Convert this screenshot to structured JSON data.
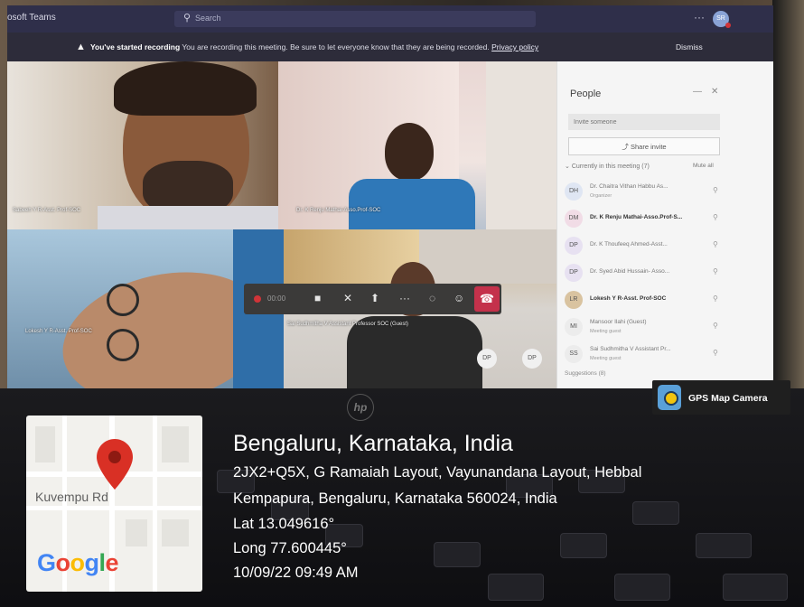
{
  "teams": {
    "app_name": "osoft Teams",
    "search_placeholder": "Search",
    "avatar_initials": "SR"
  },
  "banner": {
    "bold": "You've started recording",
    "message": "You are recording this meeting. Be sure to let everyone know that they are being recorded.",
    "link": "Privacy policy",
    "dismiss": "Dismiss"
  },
  "video": {
    "tiles": [
      {
        "label": "Sabeeh Y R-Asst. Prof-SOC"
      },
      {
        "label": "Dr. K Renju Mathai-Asso.Prof-SOC"
      },
      {
        "label": "Lokesh Y R-Asst. Prof-SOC"
      },
      {
        "label": "Sai Sudhmitha V Assistant Professor SOC (Guest)"
      }
    ],
    "dp_badges": [
      "DP",
      "DP"
    ]
  },
  "controls": {
    "timer": "00:00"
  },
  "people": {
    "title": "People",
    "invite_placeholder": "Invite someone",
    "share_invite": "Share invite",
    "section": "Currently in this meeting (7)",
    "view_all": "Mute all",
    "suggestions": "Suggestions (8)",
    "participants": [
      {
        "initials": "DH",
        "name": "Dr. Chaitra Vithan Habbu As...",
        "sub": "Organizer",
        "bold": false,
        "color": "#dfe6f3"
      },
      {
        "initials": "DM",
        "name": "Dr. K Renju Mathai-Asso.Prof-S...",
        "sub": "",
        "bold": true,
        "color": "#f1dce6"
      },
      {
        "initials": "DP",
        "name": "Dr. K Thoufeeq Ahmed-Asst...",
        "sub": "",
        "bold": false,
        "color": "#e7e1f1"
      },
      {
        "initials": "DP",
        "name": "Dr. Syed Abid Hussain- Asso...",
        "sub": "",
        "bold": false,
        "color": "#e7e1f1"
      },
      {
        "initials": "LR",
        "name": "Lokesh Y R-Asst. Prof-SOC",
        "sub": "",
        "bold": true,
        "color": "#d9c3a0"
      },
      {
        "initials": "MI",
        "name": "Mansoor Ilahi (Guest)",
        "sub": "Meeting guest",
        "bold": false,
        "color": "#ececec"
      },
      {
        "initials": "SS",
        "name": "Sai Sudhmitha V Assistant Pr...",
        "sub": "Meeting guest",
        "bold": false,
        "color": "#ececec"
      }
    ]
  },
  "laptop": {
    "brand": "hp"
  },
  "gps": {
    "app_label": "GPS Map Camera",
    "map_street": "Kuvempu Rd",
    "map_logo": "Google",
    "location_title": "Bengaluru, Karnataka, India",
    "address_line1": "2JX2+Q5X, G Ramaiah Layout, Vayunandana Layout, Hebbal",
    "address_line2": "Kempapura, Bengaluru, Karnataka 560024, India",
    "lat": "Lat 13.049616°",
    "long": "Long 77.600445°",
    "datetime": "10/09/22 09:49 AM"
  },
  "colors": {
    "teams_bar": "#2f2f4a",
    "leave_red": "#c4314b",
    "pin_red": "#d93025"
  }
}
